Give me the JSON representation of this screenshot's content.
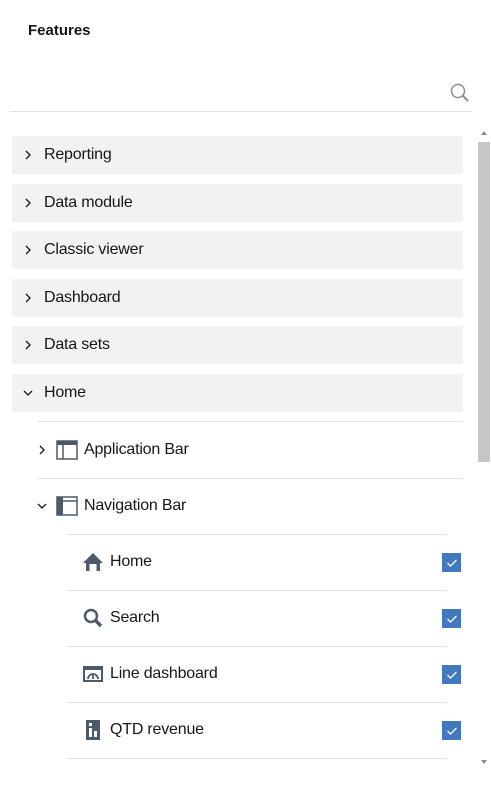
{
  "panel": {
    "title": "Features"
  },
  "search": {
    "value": "",
    "placeholder": "",
    "icon": "search-icon"
  },
  "categories": [
    {
      "label": "Reporting",
      "expanded": false
    },
    {
      "label": "Data module",
      "expanded": false
    },
    {
      "label": "Classic viewer",
      "expanded": false
    },
    {
      "label": "Dashboard",
      "expanded": false
    },
    {
      "label": "Data sets",
      "expanded": false
    },
    {
      "label": "Home",
      "expanded": true
    }
  ],
  "home": {
    "subgroups": [
      {
        "label": "Application Bar",
        "expanded": false,
        "icon": "application-bar-icon"
      },
      {
        "label": "Navigation Bar",
        "expanded": true,
        "icon": "navigation-bar-icon"
      }
    ],
    "navigation_items": [
      {
        "label": "Home",
        "icon": "home-icon",
        "checked": true
      },
      {
        "label": "Search",
        "icon": "search-icon",
        "checked": true
      },
      {
        "label": "Line dashboard",
        "icon": "dashboard-icon",
        "checked": true
      },
      {
        "label": "QTD revenue",
        "icon": "report-icon",
        "checked": true
      }
    ]
  },
  "colors": {
    "accent": "#4178be",
    "row_bg": "#f2f2f2",
    "divider": "#e0e0e0",
    "icon": "#4c5a69"
  }
}
